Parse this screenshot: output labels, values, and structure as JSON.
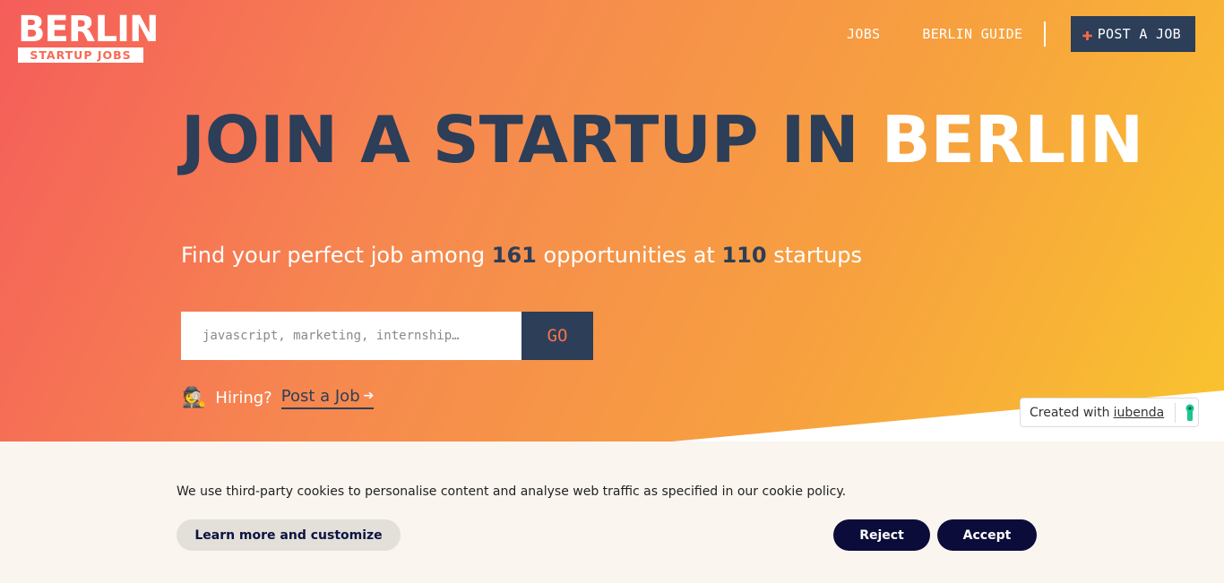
{
  "logo": {
    "main": "BERLIN",
    "sub": "STARTUP JOBS"
  },
  "nav": {
    "jobs": "JOBS",
    "guide": "BERLIN GUIDE",
    "post_job": "POST A JOB",
    "post_icon": "plus-icon"
  },
  "hero": {
    "headline_dark": "JOIN A STARTUP IN ",
    "headline_light": "BERLIN",
    "sub_prefix": "Find your perfect job among ",
    "job_count": "161",
    "sub_middle": " opportunities at ",
    "startup_count": "110",
    "sub_suffix": " startups"
  },
  "search": {
    "placeholder": "javascript, marketing, internship…",
    "value": "",
    "button": "GO"
  },
  "hiring": {
    "emoji": "🕵",
    "label": "Hiring?",
    "link": "Post a Job",
    "arrow": "➔"
  },
  "iubenda": {
    "prefix": "Created with",
    "link": "iubenda"
  },
  "cookie": {
    "text": "We use third-party cookies to personalise content and analyse web traffic as specified in our cookie policy.",
    "learn": "Learn more and customize",
    "reject": "Reject",
    "accept": "Accept"
  },
  "colors": {
    "navy": "#2c3e58",
    "orange": "#f6744d",
    "cookie_bg": "#faf5ef",
    "cookie_button": "#0b0c3a"
  }
}
